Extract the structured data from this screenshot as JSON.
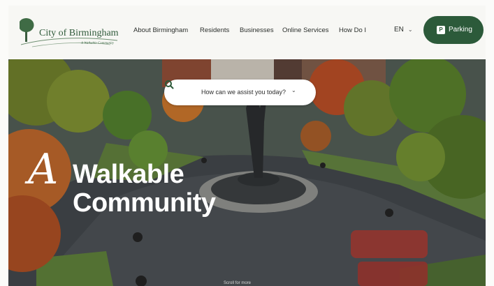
{
  "header": {
    "logo_text": "City of Birmingham",
    "logo_tagline": "A Walkable Community",
    "nav": [
      {
        "label": "About Birmingham"
      },
      {
        "label": "Residents"
      },
      {
        "label": "Businesses"
      },
      {
        "label": "Online Services"
      },
      {
        "label": "How Do I"
      }
    ],
    "language": "EN",
    "parking_label": "Parking",
    "parking_icon_letter": "P"
  },
  "hero": {
    "search_placeholder": "How can we assist you today?",
    "heading_script": "A",
    "heading_line1": "Walkable",
    "heading_line2": "Community",
    "scroll_hint": "Scroll for more"
  },
  "colors": {
    "brand_green": "#2c5a3a",
    "header_bg": "#f7f7f4"
  },
  "icons": [
    "tree-logo-icon",
    "chevron-down-icon",
    "parking-icon",
    "search-icon"
  ]
}
